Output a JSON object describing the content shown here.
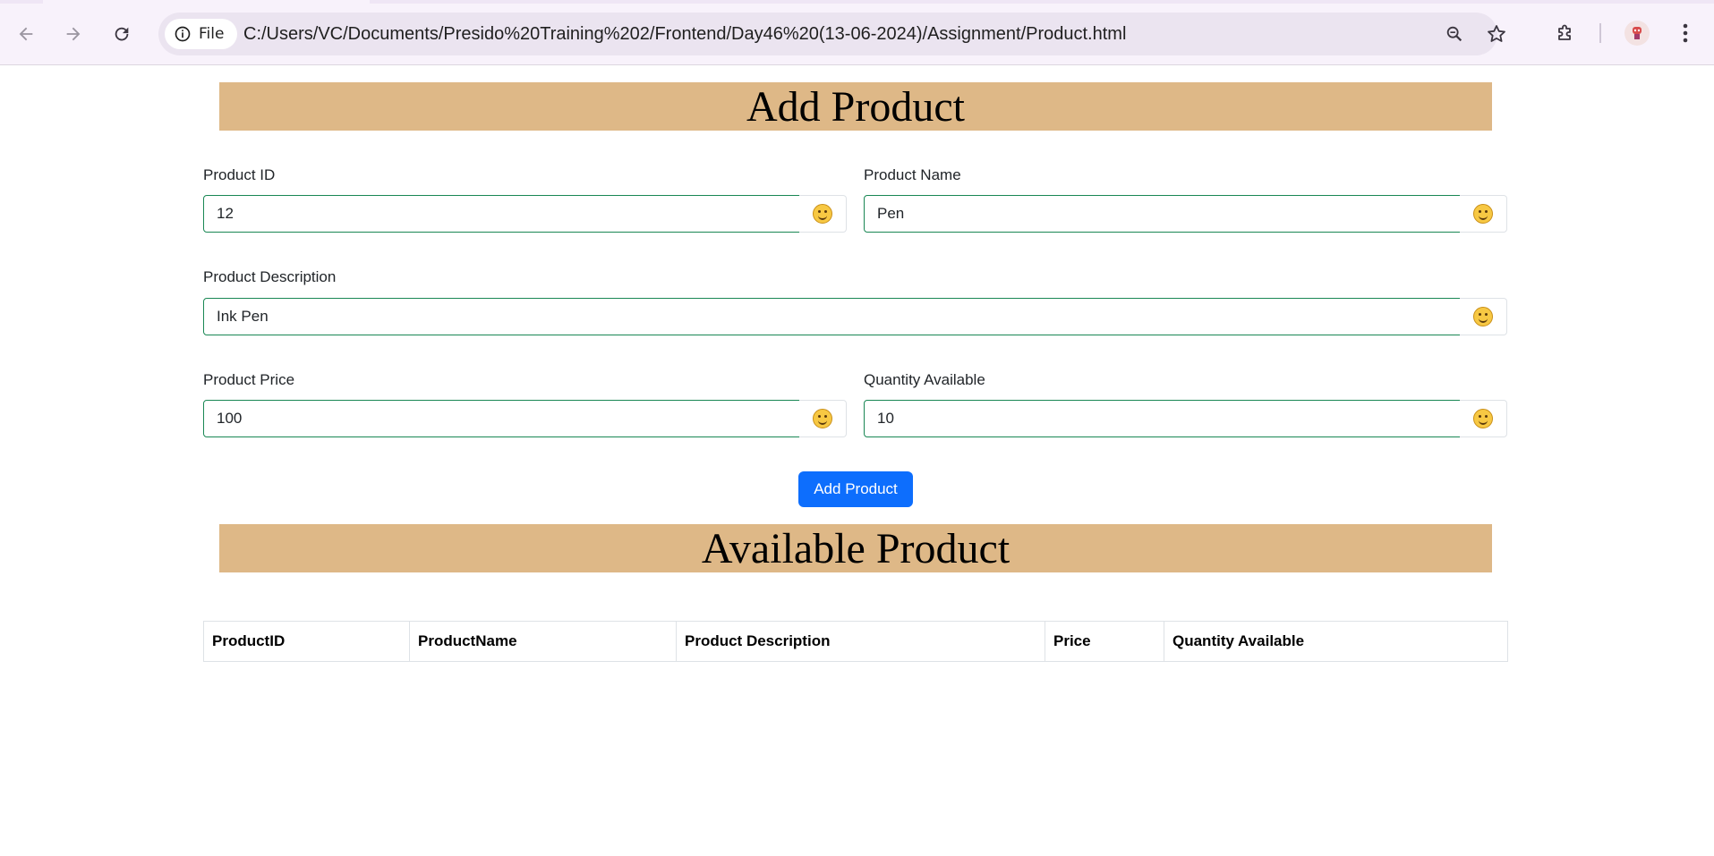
{
  "browser": {
    "site_chip_label": "File",
    "url": "C:/Users/VC/Documents/Presido%20Training%202/Frontend/Day46%20(13-06-2024)/Assignment/Product.html",
    "icons": {
      "back": "arrow-left-icon",
      "forward": "arrow-right-icon",
      "reload": "reload-icon",
      "info": "info-icon",
      "zoom": "zoom-icon",
      "bookmark": "star-icon",
      "extensions": "puzzle-icon",
      "profile": "avatar",
      "menu": "kebab-menu-icon"
    }
  },
  "page": {
    "add_title": "Add Product",
    "available_title": "Available Product",
    "banner_color": "#deb887",
    "form": {
      "product_id": {
        "label": "Product ID",
        "value": "12"
      },
      "product_name": {
        "label": "Product Name",
        "value": "Pen"
      },
      "product_description": {
        "label": "Product Description",
        "value": "Ink Pen"
      },
      "product_price": {
        "label": "Product Price",
        "value": "100"
      },
      "quantity_available": {
        "label": "Quantity Available",
        "value": "10"
      },
      "valid_icon": "smiley-icon",
      "submit_label": "Add Product"
    },
    "table": {
      "headers": [
        "ProductID",
        "ProductName",
        "Product Description",
        "Price",
        "Quantity Available"
      ],
      "rows": []
    }
  }
}
